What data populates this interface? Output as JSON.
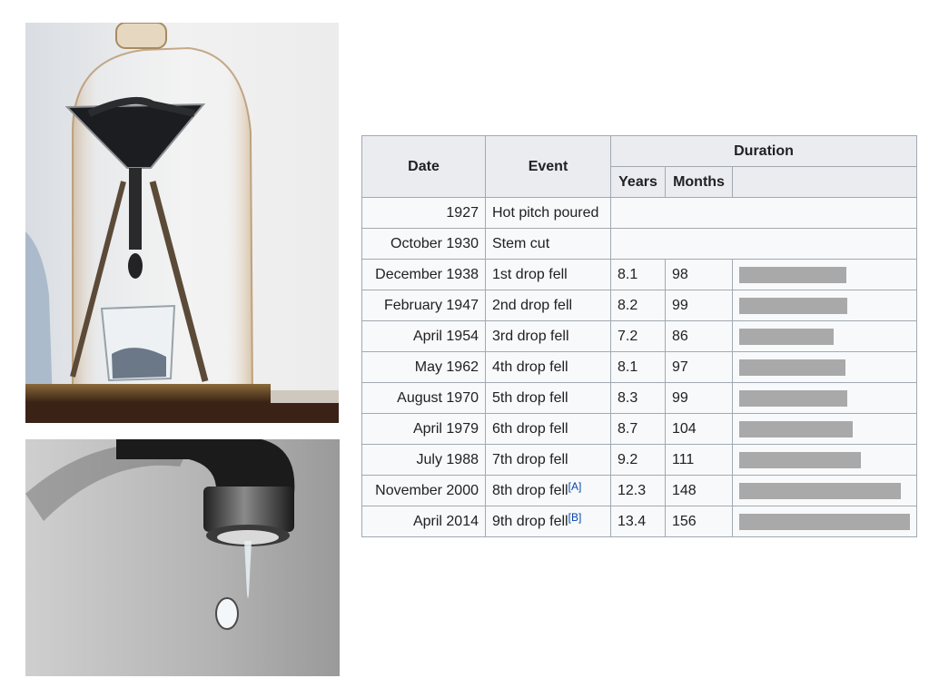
{
  "images": {
    "apparatus": {
      "icon": "pitch-drop-apparatus-icon"
    },
    "tap": {
      "icon": "dripping-tap-icon"
    }
  },
  "table": {
    "headers": {
      "date": "Date",
      "event": "Event",
      "duration": "Duration",
      "years": "Years",
      "months": "Months"
    },
    "bar_max_months": 156,
    "bar_color": "#a9a9a9",
    "rows": [
      {
        "date": "1927",
        "event": "Hot pitch poured",
        "ref": "",
        "years": "",
        "months": ""
      },
      {
        "date": "October 1930",
        "event": "Stem cut",
        "ref": "",
        "years": "",
        "months": ""
      },
      {
        "date": "December 1938",
        "event": "1st drop fell",
        "ref": "",
        "years": "8.1",
        "months": "98"
      },
      {
        "date": "February 1947",
        "event": "2nd drop fell",
        "ref": "",
        "years": "8.2",
        "months": "99"
      },
      {
        "date": "April 1954",
        "event": "3rd drop fell",
        "ref": "",
        "years": "7.2",
        "months": "86"
      },
      {
        "date": "May 1962",
        "event": "4th drop fell",
        "ref": "",
        "years": "8.1",
        "months": "97"
      },
      {
        "date": "August 1970",
        "event": "5th drop fell",
        "ref": "",
        "years": "8.3",
        "months": "99"
      },
      {
        "date": "April 1979",
        "event": "6th drop fell",
        "ref": "",
        "years": "8.7",
        "months": "104"
      },
      {
        "date": "July 1988",
        "event": "7th drop fell",
        "ref": "",
        "years": "9.2",
        "months": "111"
      },
      {
        "date": "November 2000",
        "event": "8th drop fell",
        "ref": "[A]",
        "years": "12.3",
        "months": "148"
      },
      {
        "date": "April 2014",
        "event": "9th drop fell",
        "ref": "[B]",
        "years": "13.4",
        "months": "156"
      }
    ]
  }
}
